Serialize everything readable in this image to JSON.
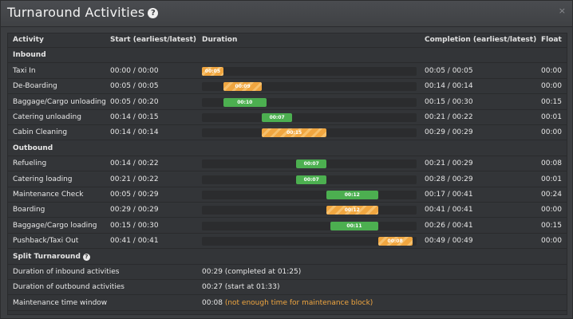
{
  "window": {
    "title": "Turnaround Activities",
    "close_glyph": "×"
  },
  "table": {
    "headers": {
      "activity": "Activity",
      "start": "Start (earliest/latest)",
      "duration": "Duration",
      "completion": "Completion (earliest/latest)",
      "float": "Float"
    },
    "timeline_total_minutes": 50,
    "sections": [
      {
        "label": "Inbound",
        "rows": [
          {
            "activity": "Taxi In",
            "start": "00:00 / 00:00",
            "completion": "00:05 / 00:05",
            "float": "00:00",
            "bar": {
              "label": "00:05",
              "color": "orange",
              "start_min": 0,
              "end_min": 5
            }
          },
          {
            "activity": "De-Boarding",
            "start": "00:05 / 00:05",
            "completion": "00:14 / 00:14",
            "float": "00:00",
            "bar": {
              "label": "00:09",
              "color": "orange",
              "start_min": 5,
              "end_min": 14
            }
          },
          {
            "activity": "Baggage/Cargo unloading",
            "start": "00:05 / 00:20",
            "completion": "00:15 / 00:30",
            "float": "00:15",
            "bar": {
              "label": "00:10",
              "color": "green",
              "start_min": 5,
              "end_min": 15
            }
          },
          {
            "activity": "Catering unloading",
            "start": "00:14 / 00:15",
            "completion": "00:21 / 00:22",
            "float": "00:01",
            "bar": {
              "label": "00:07",
              "color": "green",
              "start_min": 14,
              "end_min": 21
            }
          },
          {
            "activity": "Cabin Cleaning",
            "start": "00:14 / 00:14",
            "completion": "00:29 / 00:29",
            "float": "00:00",
            "bar": {
              "label": "00:15",
              "color": "orange",
              "start_min": 14,
              "end_min": 29
            }
          }
        ]
      },
      {
        "label": "Outbound",
        "rows": [
          {
            "activity": "Refueling",
            "start": "00:14 / 00:22",
            "completion": "00:21 / 00:29",
            "float": "00:08",
            "bar": {
              "label": "00:07",
              "color": "green",
              "start_min": 22,
              "end_min": 29
            }
          },
          {
            "activity": "Catering loading",
            "start": "00:21 / 00:22",
            "completion": "00:28 / 00:29",
            "float": "00:01",
            "bar": {
              "label": "00:07",
              "color": "green",
              "start_min": 22,
              "end_min": 29
            }
          },
          {
            "activity": "Maintenance Check",
            "start": "00:05 / 00:29",
            "completion": "00:17 / 00:41",
            "float": "00:24",
            "bar": {
              "label": "00:12",
              "color": "green",
              "start_min": 29,
              "end_min": 41
            }
          },
          {
            "activity": "Boarding",
            "start": "00:29 / 00:29",
            "completion": "00:41 / 00:41",
            "float": "00:00",
            "bar": {
              "label": "00:12",
              "color": "orange",
              "start_min": 29,
              "end_min": 41
            }
          },
          {
            "activity": "Baggage/Cargo loading",
            "start": "00:15 / 00:30",
            "completion": "00:26 / 00:41",
            "float": "00:15",
            "bar": {
              "label": "00:11",
              "color": "green",
              "start_min": 30,
              "end_min": 41
            }
          },
          {
            "activity": "Pushback/Taxi Out",
            "start": "00:41 / 00:41",
            "completion": "00:49 / 00:49",
            "float": "00:00",
            "bar": {
              "label": "00:08",
              "color": "orange",
              "start_min": 41,
              "end_min": 49
            }
          }
        ]
      }
    ]
  },
  "split": {
    "label": "Split Turnaround",
    "rows": [
      {
        "label": "Duration of inbound activities",
        "value": "00:29 (completed at 01:25)",
        "warning": ""
      },
      {
        "label": "Duration of outbound activities",
        "value": "00:27 (start at 01:33)",
        "warning": ""
      },
      {
        "label": "Maintenance time window",
        "value": "00:08",
        "warning": "(not enough time for maintenance block)"
      }
    ]
  },
  "colors": {
    "green": "#4caf50",
    "orange": "#f0a640",
    "warning_text": "#f0a640"
  },
  "icons": {
    "title_help": "help-icon",
    "split_help": "help-icon",
    "close": "close-icon"
  }
}
